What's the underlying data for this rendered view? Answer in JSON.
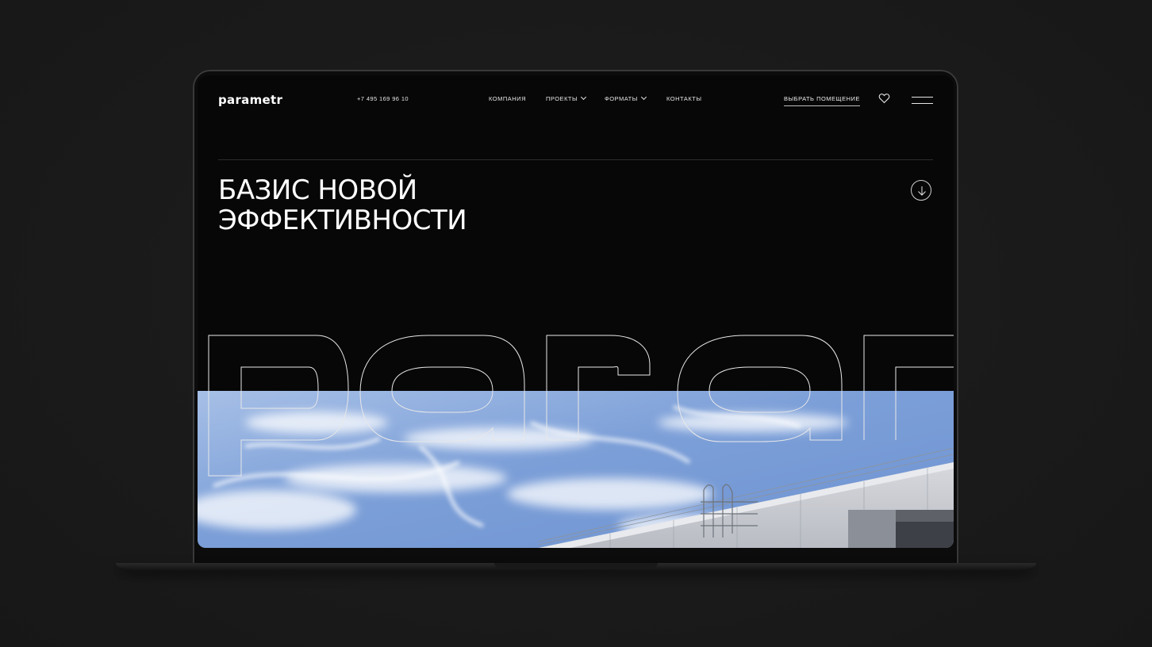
{
  "header": {
    "logo": "parametr",
    "phone": "+7 495 169 96 10",
    "nav": {
      "company": "КОМПАНИЯ",
      "projects": "ПРОЕКТЫ",
      "formats": "ФОРМАТЫ",
      "contacts": "КОНТАКТЫ"
    },
    "cta": "ВЫБРАТЬ ПОМЕЩЕНИЕ"
  },
  "hero": {
    "headline_line1": "БАЗИС НОВОЙ",
    "headline_line2": "ЭФФЕКТИВНОСТИ",
    "outline_word": "param"
  },
  "colors": {
    "background": "#1b1b1b",
    "screen": "#070707",
    "text": "#ffffff",
    "sky": "#7b9fd6"
  },
  "icons": {
    "favorites": "heart-icon",
    "menu": "menu-icon",
    "scroll": "arrow-down-icon",
    "dropdown": "chevron-down-icon"
  }
}
